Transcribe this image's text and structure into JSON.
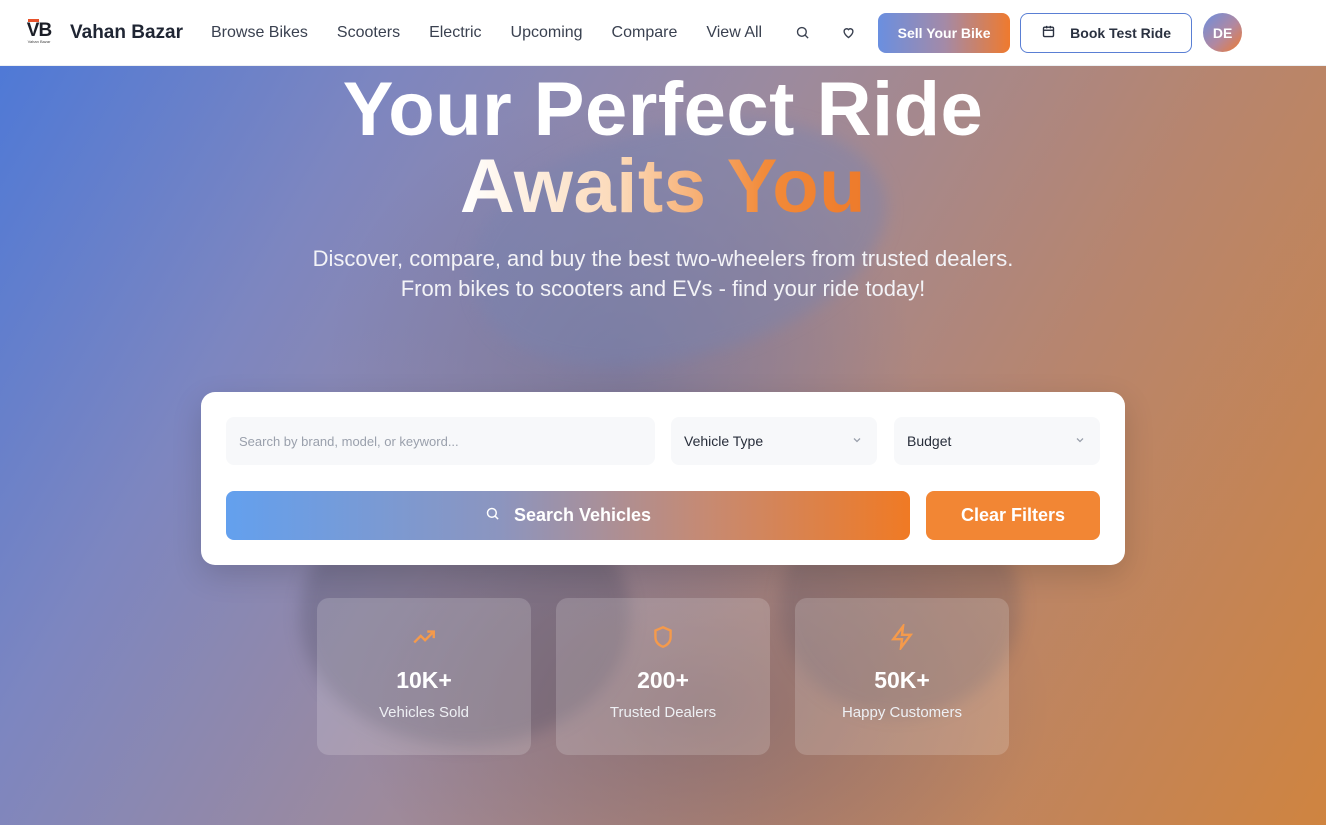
{
  "nav": {
    "logo_text": "VB",
    "logo_subtext": "Vahan Bazar",
    "brand": "Vahan Bazar",
    "links": [
      "Browse Bikes",
      "Scooters",
      "Electric",
      "Upcoming",
      "Compare",
      "View All"
    ],
    "sell_label": "Sell Your Bike",
    "test_ride_label": "Book Test Ride",
    "avatar_initials": "DE"
  },
  "hero": {
    "title_line1": "Your Perfect Ride",
    "title_line2": "Awaits You",
    "subtitle": "Discover, compare, and buy the best two-wheelers from trusted dealers. From bikes to scooters and EVs - find your ride today!"
  },
  "search": {
    "placeholder": "Search by brand, model, or keyword...",
    "vehicle_type": "Vehicle Type",
    "budget": "Budget",
    "search_label": "Search Vehicles",
    "clear_label": "Clear Filters"
  },
  "stats": [
    {
      "icon": "trending-up-icon",
      "value": "10K+",
      "label": "Vehicles Sold"
    },
    {
      "icon": "shield-icon",
      "value": "200+",
      "label": "Trusted Dealers"
    },
    {
      "icon": "lightning-icon",
      "value": "50K+",
      "label": "Happy Customers"
    }
  ],
  "colors": {
    "accent_orange": "#F28634",
    "accent_blue": "#5A7FD4",
    "icon_orange": "#F59A4B"
  }
}
